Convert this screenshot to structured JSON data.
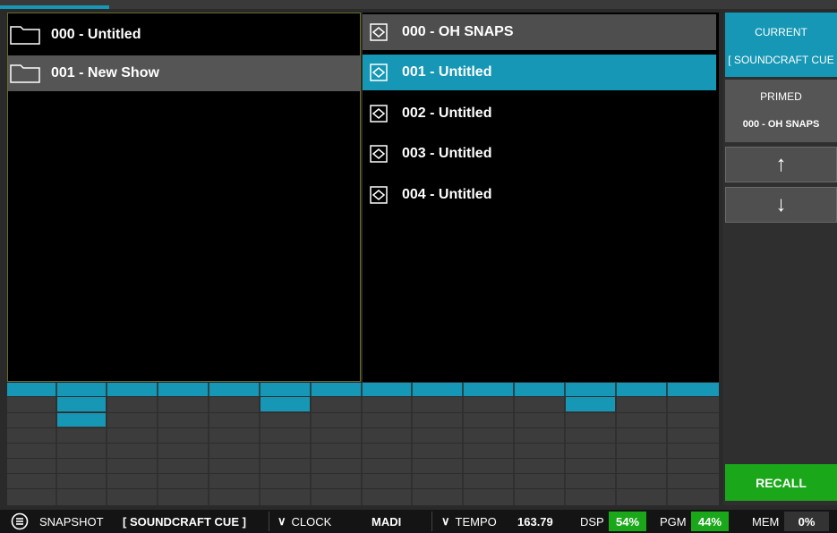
{
  "shows": [
    {
      "label": "000 - Untitled",
      "selected": false
    },
    {
      "label": "001 - New Show",
      "selected": true
    }
  ],
  "snapshots": [
    {
      "label": "000 - OH SNAPS",
      "state": "primed"
    },
    {
      "label": "001 - Untitled",
      "state": "current"
    },
    {
      "label": "002 - Untitled",
      "state": "normal"
    },
    {
      "label": "003 - Untitled",
      "state": "normal"
    },
    {
      "label": "004 - Untitled",
      "state": "normal"
    }
  ],
  "side": {
    "current_label": "CURRENT",
    "current_value": "[ SOUNDCRAFT CUE",
    "primed_label": "PRIMED",
    "primed_value": "000 - OH SNAPS",
    "up_glyph": "↑",
    "down_glyph": "↓",
    "recall_label": "RECALL"
  },
  "statusbar": {
    "menu_glyph": "☰",
    "mode_label": "SNAPSHOT",
    "mode_value": "[ SOUNDCRAFT CUE ]",
    "clock_label": "CLOCK",
    "clock_value": "MADI",
    "tempo_label": "TEMPO",
    "tempo_value": "163.79",
    "dsp_label": "DSP",
    "dsp_value": "54%",
    "pgm_label": "PGM",
    "pgm_value": "44%",
    "mem_label": "MEM",
    "mem_value": "0%",
    "chevron_glyph": "∨"
  },
  "colors": {
    "accent": "#1597b5",
    "ok_green": "#1aa81a"
  }
}
